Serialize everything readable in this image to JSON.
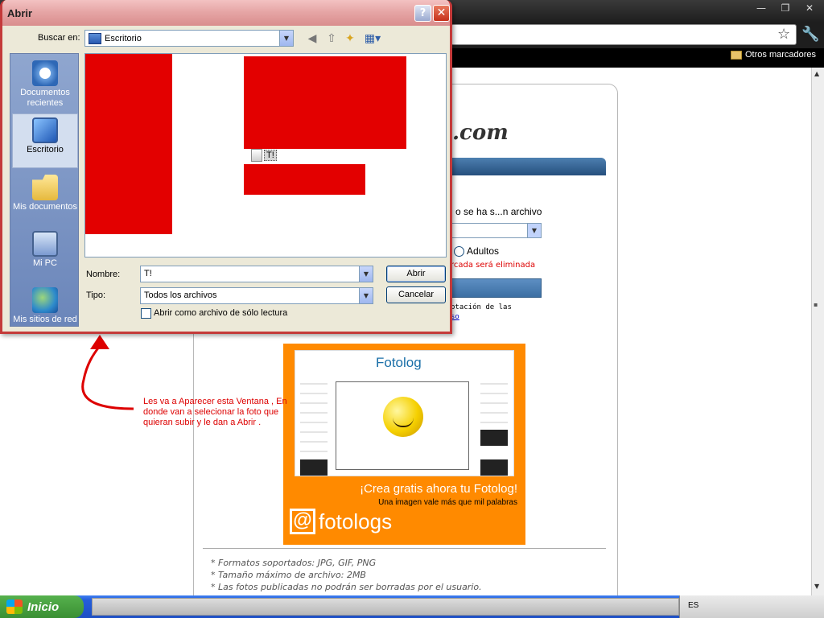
{
  "browser": {
    "bookmarks": {
      "other": "Otros marcadores"
    },
    "win_buttons": [
      "—",
      "❐",
      "✕"
    ]
  },
  "page": {
    "logo": ".com",
    "upload_text": "o se ha s...n archivo",
    "radio_label": "Adultos",
    "warning": "rcada será eliminada",
    "accept_line1": "ptación de las",
    "accept_link": "so",
    "notes": [
      "* Formatos soportados: JPG, GIF, PNG",
      "* Tamaño máximo de archivo: 2MB",
      "* Las fotos publicadas no podrán ser borradas por el usuario."
    ],
    "banner": {
      "title": "Fotolog",
      "slogan": "¡Crea gratis ahora tu Fotolog!",
      "subslogan": "Una imagen vale más que mil palabras",
      "logo_text": "fotologs"
    }
  },
  "annotation": "Les va a Aparecer esta Ventana , En donde van a selecionar la foto que quieran subir y le dan a Abrir .",
  "dialog": {
    "title": "Abrir",
    "help_label": "?",
    "close_label": "✕",
    "lookin_label": "Buscar en:",
    "lookin_value": "Escritorio",
    "places": [
      {
        "label": "Documentos recientes",
        "icon": "recent-documents-icon"
      },
      {
        "label": "Escritorio",
        "icon": "desktop-icon"
      },
      {
        "label": "Mis documentos",
        "icon": "my-documents-icon"
      },
      {
        "label": "Mi PC",
        "icon": "my-computer-icon"
      },
      {
        "label": "Mis sitios de red",
        "icon": "network-places-icon"
      }
    ],
    "file_item": "T!",
    "filename_label": "Nombre:",
    "filename_value": "T!",
    "filetype_label": "Tipo:",
    "filetype_value": "Todos los archivos",
    "readonly_label": "Abrir como archivo de sólo lectura",
    "open_button": "Abrir",
    "cancel_button": "Cancelar"
  },
  "taskbar": {
    "start": "Inicio",
    "lang": "ES"
  }
}
